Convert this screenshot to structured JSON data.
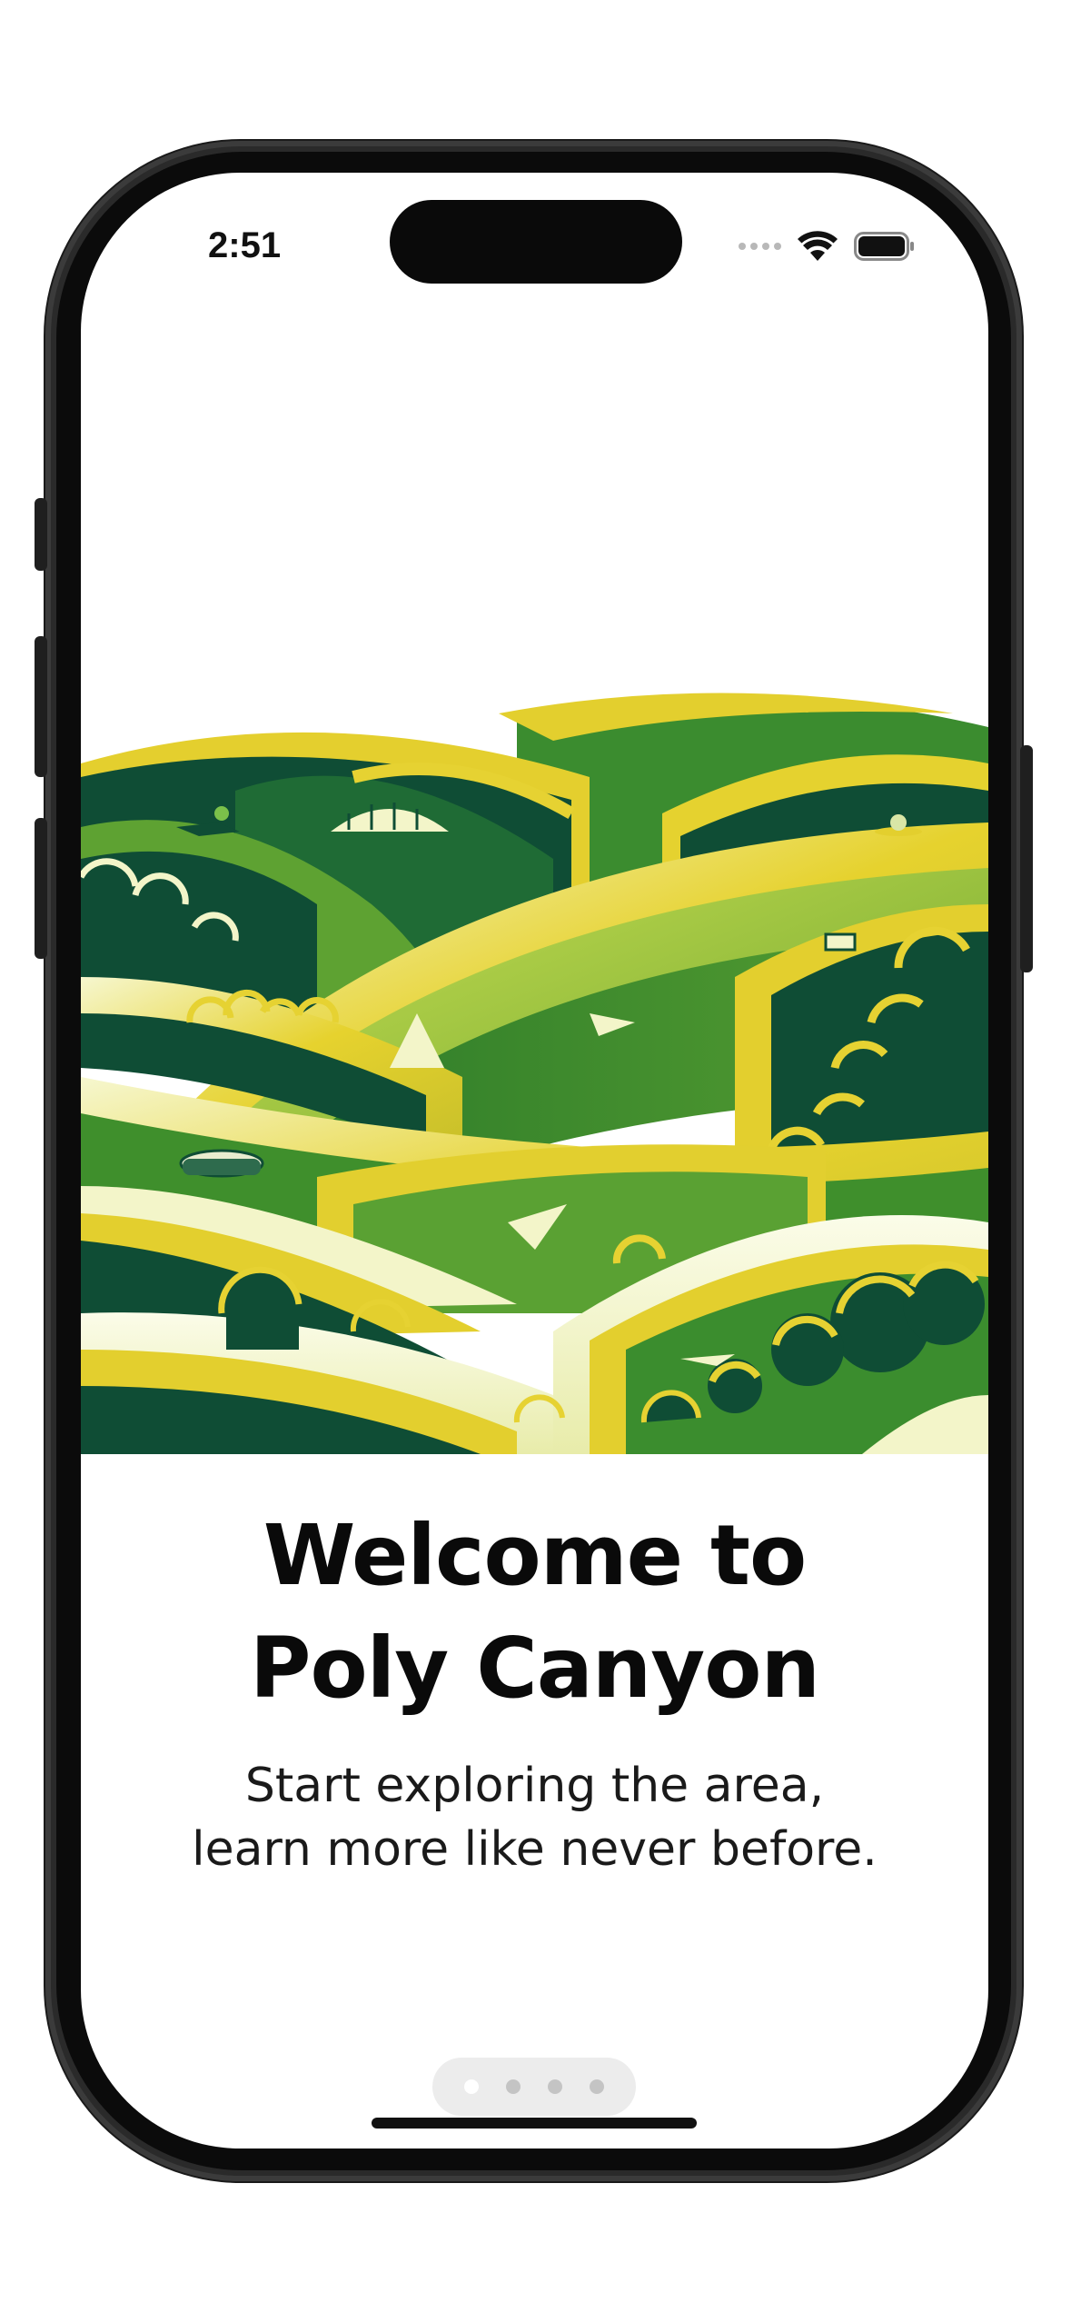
{
  "status_bar": {
    "time": "2:51",
    "icons": [
      "cellular-signal-icon",
      "wifi-icon",
      "battery-icon"
    ]
  },
  "onboarding": {
    "hero_image": "rolling-green-hills-illustration",
    "title_line_1": "Welcome to",
    "title_line_2": "Poly Canyon",
    "subtitle_line_1": "Start exploring the area,",
    "subtitle_line_2": "learn more like never before.",
    "page_indicator": {
      "total_pages": 4,
      "current_page": 1
    }
  },
  "colors": {
    "dark_green": "#0f4d35",
    "mid_green": "#3e8f2a",
    "lime": "#9cc23a",
    "yellow": "#e4cf2c",
    "cream": "#f3f5c9"
  }
}
